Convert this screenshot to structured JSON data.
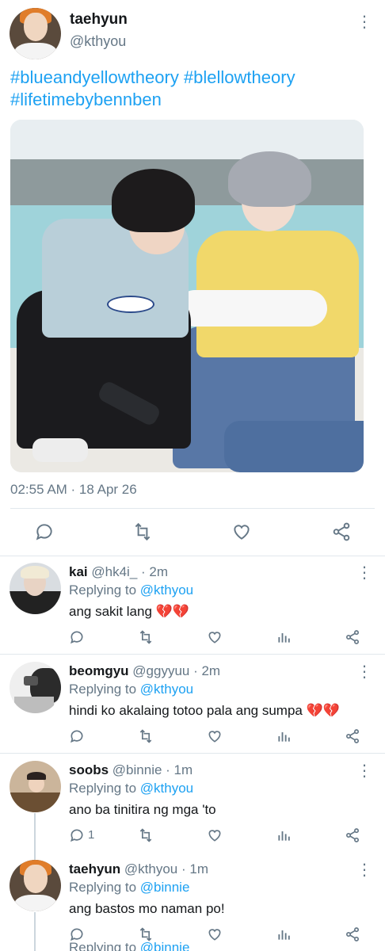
{
  "main_tweet": {
    "name": "taehyun",
    "handle": "@kthyou",
    "hashtags": "#blueandyellowtheory #blellowtheory #lifetimebybennben",
    "timestamp": "02:55 AM · 18 Apr 26",
    "icons": [
      "reply-icon",
      "retweet-icon",
      "like-icon",
      "share-icon"
    ]
  },
  "replies": [
    {
      "name": "kai",
      "meta": "@hk4i_ · 2m",
      "replying_prefix": "Replying to ",
      "replying_to": "@kthyou",
      "text": "ang sakit lang",
      "emoji": "💔💔",
      "reply_count": ""
    },
    {
      "name": "beomgyu",
      "meta": "@ggyyuu · 2m",
      "replying_prefix": "Replying to ",
      "replying_to": "@kthyou",
      "text": "hindi ko akalaing totoo pala ang sumpa",
      "emoji": "💔💔",
      "reply_count": ""
    },
    {
      "name": "soobs",
      "meta": "@binnie · 1m",
      "replying_prefix": "Replying to ",
      "replying_to": "@kthyou",
      "text": "ano ba tinitira ng mga 'to",
      "emoji": "",
      "reply_count": "1"
    },
    {
      "name": "taehyun",
      "meta": "@kthyou · 1m",
      "replying_prefix": "Replying to ",
      "replying_to": "@binnie",
      "text": "ang bastos mo naman po!",
      "emoji": "",
      "reply_count": ""
    }
  ],
  "partial_next": {
    "replying_prefix": "Replying to ",
    "replying_to": "@binnie"
  },
  "colors": {
    "accent": "#1da1f2",
    "muted": "#657786",
    "divider": "#e1e8ed",
    "broken_heart": "#d4213d"
  }
}
